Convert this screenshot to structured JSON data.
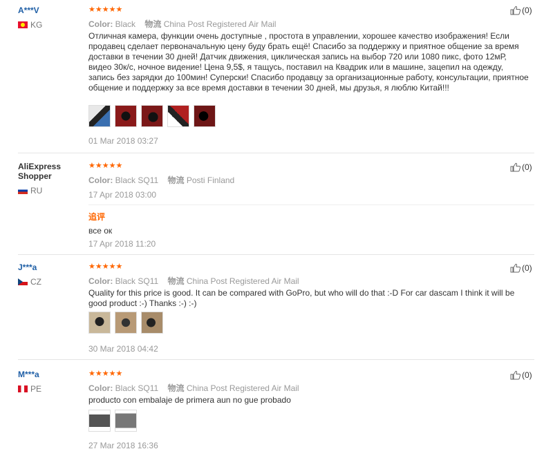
{
  "reviews": [
    {
      "user": "A***V",
      "country": "KG",
      "rating": "★★★★★",
      "color_label": "Color:",
      "color_value": "Black",
      "shipping_label": "物流",
      "shipping_value": "China Post Registered Air Mail",
      "text": "Отличная камера, функции очень доступные , простота в управлении, хорошее качество изображения! Если продавец сделает первоначальную цену буду брать ещё! Спасибо за поддержку и приятное общение за время доставки в течении 30 дней! Датчик движения, циклическая запись на выбор 720 или 1080 пикс, фото 12мР, видео 30к/с, ночное видение! Цена 9,5$, я тащусь, поставил на Квадрик или в машине, зацепил на одежду, запись без зарядки до 100мин! Суперски! Спасибо продавцу за организационные работу, консультации, приятное общение и поддержку за все время доставки в течении 30 дней, мы друзья, я люблю Китай!!!",
      "date": "01 Mar 2018 03:27",
      "helpful": "(0)"
    },
    {
      "user": "AliExpress Shopper",
      "country": "RU",
      "rating": "★★★★★",
      "color_label": "Color:",
      "color_value": "Black SQ11",
      "shipping_label": "物流",
      "shipping_value": "Posti Finland",
      "date": "17 Apr 2018 03:00",
      "followup_label": "追评",
      "followup_text": "все ок",
      "followup_date": "17 Apr 2018 11:20",
      "helpful": "(0)"
    },
    {
      "user": "J***a",
      "country": "CZ",
      "rating": "★★★★★",
      "color_label": "Color:",
      "color_value": "Black SQ11",
      "shipping_label": "物流",
      "shipping_value": "China Post Registered Air Mail",
      "text": "Quality for this price is good. It can be compared with GoPro, but who will do that :-D For car dascam I think it will be good product :-) Thanks :-) :-)",
      "date": "30 Mar 2018 04:42",
      "helpful": "(0)"
    },
    {
      "user": "M***a",
      "country": "PE",
      "rating": "★★★★★",
      "color_label": "Color:",
      "color_value": "Black SQ11",
      "shipping_label": "物流",
      "shipping_value": "China Post Registered Air Mail",
      "text": "producto con embalaje de primera aun no gue probado",
      "date": "27 Mar 2018 16:36",
      "helpful": "(0)"
    }
  ],
  "colors": {
    "link": "#1f5fa6",
    "star": "#ff6600",
    "followup": "#ff6600",
    "muted": "#999999"
  }
}
